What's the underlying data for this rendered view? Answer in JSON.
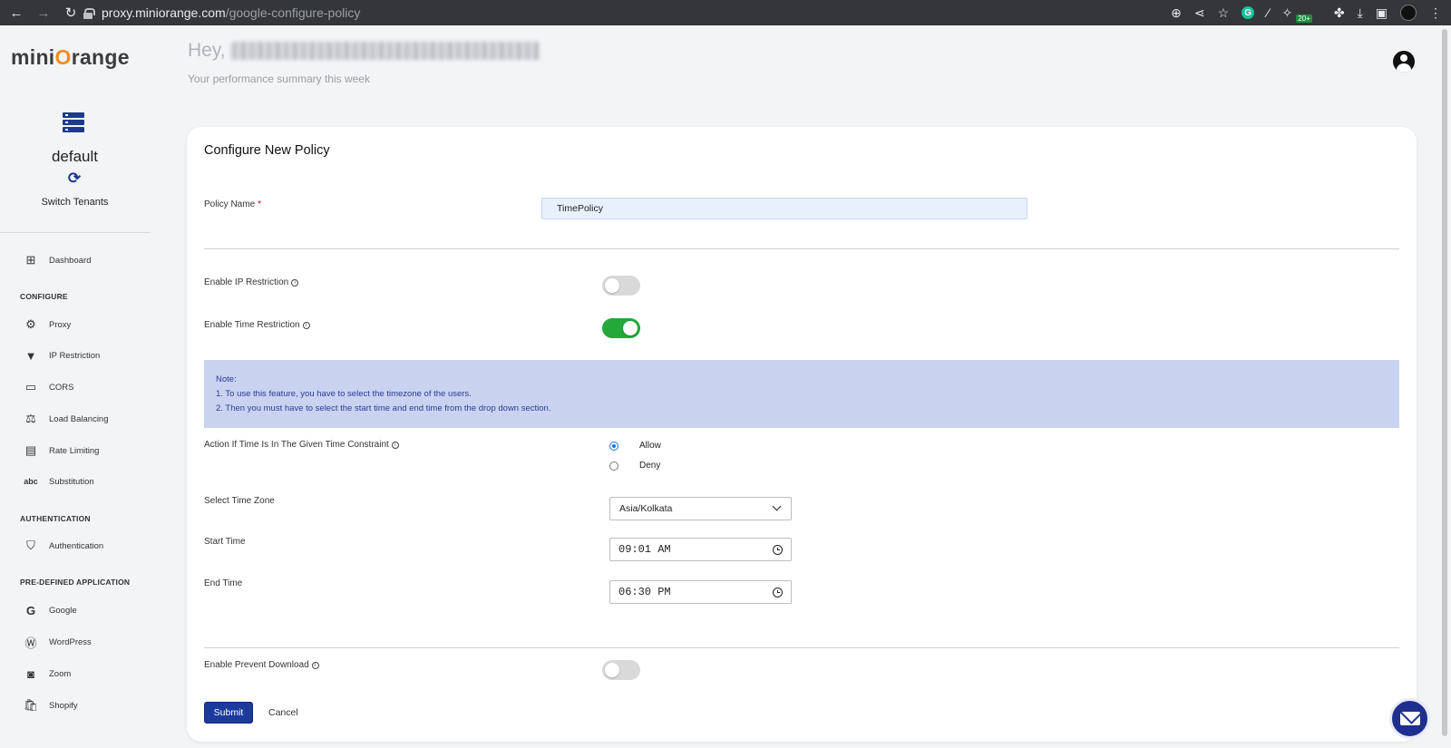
{
  "browser": {
    "url_host": "proxy.miniorange.com",
    "url_path": "/google-configure-policy",
    "extension_badge": "20+"
  },
  "sidebar": {
    "logo": {
      "pre": "mini",
      "o": "O",
      "post": "range"
    },
    "tenant_name": "default",
    "switch_label": "Switch Tenants",
    "dashboard": "Dashboard",
    "sections": {
      "configure": "CONFIGURE",
      "authentication": "AUTHENTICATION",
      "predefined": "PRE-DEFINED APPLICATION"
    },
    "configure_items": [
      "Proxy",
      "IP Restriction",
      "CORS",
      "Load Balancing",
      "Rate Limiting",
      "Substitution"
    ],
    "authentication_item": "Authentication",
    "app_items": [
      "Google",
      "WordPress",
      "Zoom",
      "Shopify"
    ]
  },
  "header": {
    "greeting": "Hey,",
    "summary": "Your performance summary this week"
  },
  "form": {
    "title": "Configure New Policy",
    "policy_name_label": "Policy Name",
    "required_mark": "*",
    "policy_name_value": "TimePolicy",
    "ip_restriction_label": "Enable IP Restriction",
    "ip_restriction_on": false,
    "time_restriction_label": "Enable Time Restriction",
    "time_restriction_on": true,
    "note": {
      "title": "Note:",
      "line1": "1. To use this feature, you have to select the timezone of the users.",
      "line2": "2. Then you must have to select the start time and end time from the drop down section."
    },
    "action_label": "Action If Time Is In The Given Time Constraint",
    "action_options": [
      "Allow",
      "Deny"
    ],
    "action_selected": "Allow",
    "timezone_label": "Select Time Zone",
    "timezone_value": "Asia/Kolkata",
    "start_time_label": "Start Time",
    "start_time_value": "09:01 AM",
    "end_time_label": "End Time",
    "end_time_value": "06:30 PM",
    "prevent_download_label": "Enable Prevent Download",
    "prevent_download_on": false,
    "submit_label": "Submit",
    "cancel_label": "Cancel"
  },
  "colors": {
    "brand_blue": "#1b3a9c",
    "toggle_on": "#22a93a",
    "note_bg": "#c9d3f0",
    "logo_orange": "#f28c1e"
  }
}
